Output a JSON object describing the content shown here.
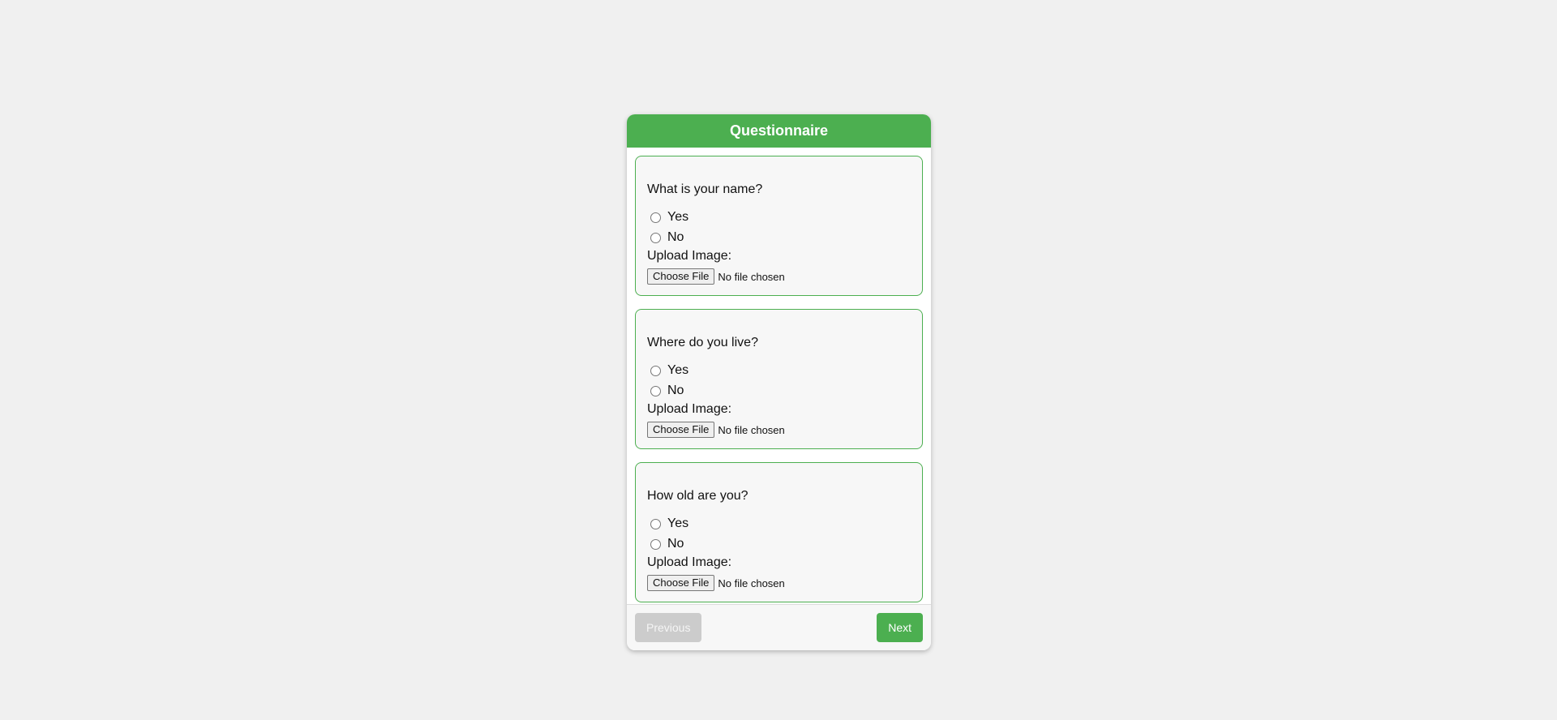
{
  "header": {
    "title": "Questionnaire"
  },
  "questions": [
    {
      "text": "What is your name?",
      "options": [
        "Yes",
        "No"
      ],
      "upload_label": "Upload Image:",
      "file_button": "Choose File",
      "file_status": "No file chosen"
    },
    {
      "text": "Where do you live?",
      "options": [
        "Yes",
        "No"
      ],
      "upload_label": "Upload Image:",
      "file_button": "Choose File",
      "file_status": "No file chosen"
    },
    {
      "text": "How old are you?",
      "options": [
        "Yes",
        "No"
      ],
      "upload_label": "Upload Image:",
      "file_button": "Choose File",
      "file_status": "No file chosen"
    }
  ],
  "footer": {
    "previous_label": "Previous",
    "previous_disabled": true,
    "next_label": "Next"
  },
  "colors": {
    "accent": "#4caf50",
    "disabled": "#cccccc"
  }
}
